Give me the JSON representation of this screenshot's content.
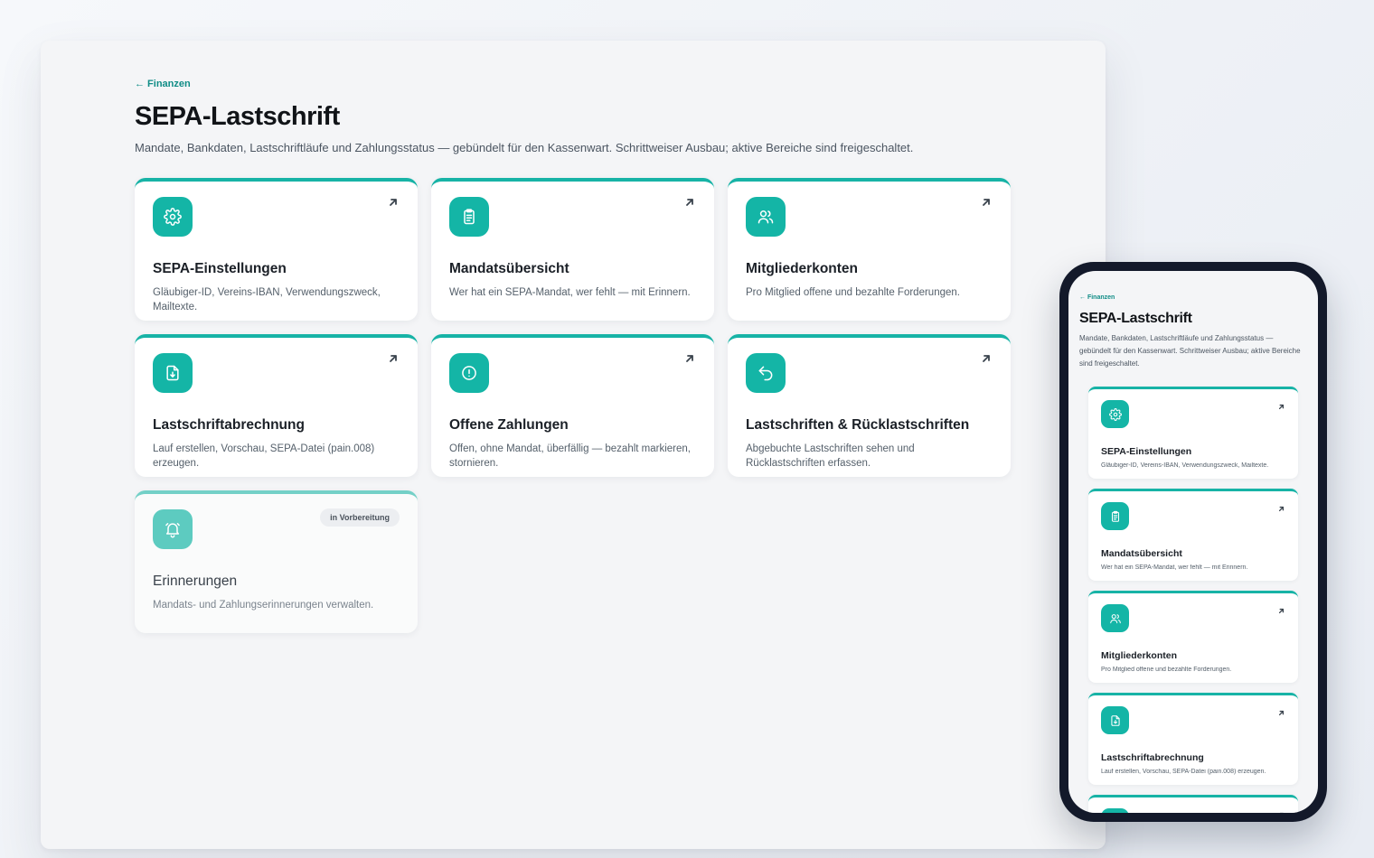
{
  "nav": {
    "back_label": "← Finanzen"
  },
  "page": {
    "title": "SEPA-Lastschrift",
    "subtitle": "Mandate, Bankdaten, Lastschriftläufe und Zahlungsstatus — gebündelt für den Kassenwart. Schrittweiser Ausbau; aktive Bereiche sind freigeschaltet."
  },
  "cards": [
    {
      "title": "SEPA-Einstellungen",
      "desc": "Gläubiger-ID, Vereins-IBAN, Verwendungszweck, Mailtexte.",
      "icon": "gear-icon",
      "status": "active"
    },
    {
      "title": "Mandatsübersicht",
      "desc": "Wer hat ein SEPA-Mandat, wer fehlt — mit Erinnern.",
      "icon": "clipboard-icon",
      "status": "active"
    },
    {
      "title": "Mitgliederkonten",
      "desc": "Pro Mitglied offene und bezahlte Forderungen.",
      "icon": "users-icon",
      "status": "active"
    },
    {
      "title": "Lastschriftabrechnung",
      "desc": "Lauf erstellen, Vorschau, SEPA-Datei (pain.008) erzeugen.",
      "icon": "file-download-icon",
      "status": "active"
    },
    {
      "title": "Offene Zahlungen",
      "desc": "Offen, ohne Mandat, überfällig — bezahlt markieren, stornieren.",
      "icon": "alert-circle-icon",
      "status": "active"
    },
    {
      "title": "Lastschriften & Rücklastschriften",
      "desc": "Abgebuchte Lastschriften sehen und Rücklastschriften erfassen.",
      "icon": "undo-icon",
      "status": "active"
    },
    {
      "title": "Erinnerungen",
      "desc": "Mandats- und Zahlungserinnerungen verwalten.",
      "icon": "bell-icon",
      "status": "disabled",
      "badge": "in Vorbereitung"
    }
  ],
  "colors": {
    "accent": "#14b5a6",
    "link": "#0f8c86",
    "accent_muted": "#5dcbc0"
  }
}
